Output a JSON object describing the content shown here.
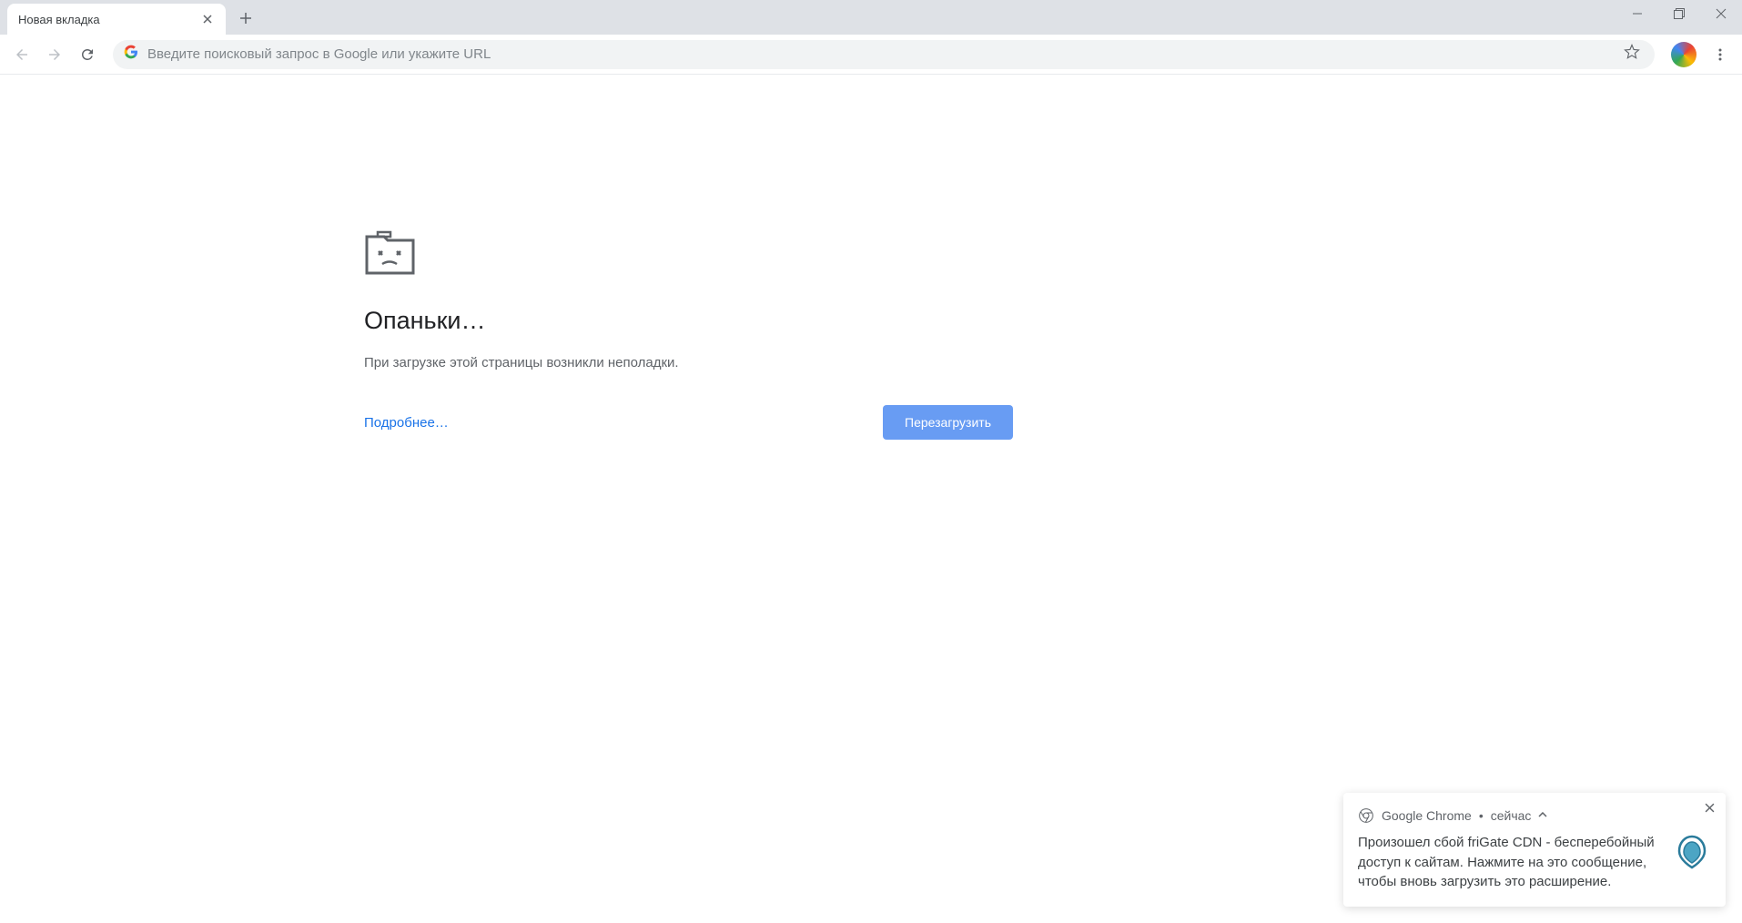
{
  "tab": {
    "title": "Новая вкладка"
  },
  "omnibox": {
    "placeholder": "Введите поисковый запрос в Google или укажите URL"
  },
  "error": {
    "title": "Опаньки…",
    "message": "При загрузке этой страницы возникли неполадки.",
    "learn_more": "Подробнее…",
    "reload": "Перезагрузить"
  },
  "notification": {
    "app": "Google Chrome",
    "separator": "•",
    "time": "сейчас",
    "text": "Произошел сбой friGate CDN - бесперебойный доступ к сайтам. Нажмите на это сообщение, чтобы вновь загрузить это расширение."
  }
}
